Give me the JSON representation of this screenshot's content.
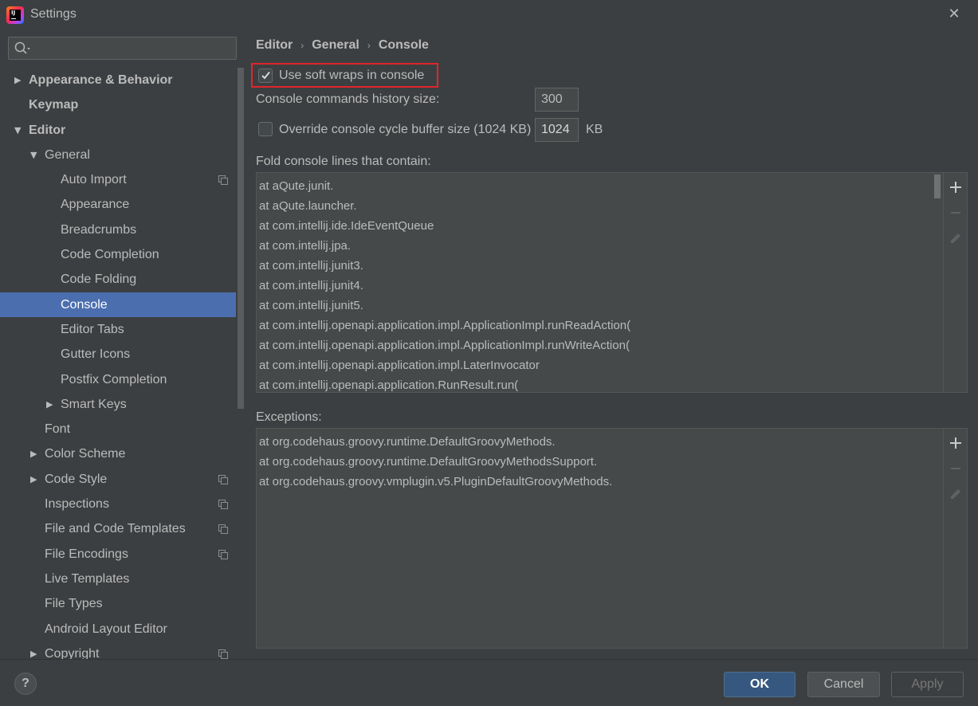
{
  "window": {
    "title": "Settings",
    "close_glyph": "✕"
  },
  "search": {
    "placeholder": "",
    "value": ""
  },
  "sidebar": {
    "items": [
      {
        "label": "Appearance & Behavior",
        "level": 0,
        "arrow": "right",
        "bold": true,
        "selected": false,
        "icon": ""
      },
      {
        "label": "Keymap",
        "level": 0,
        "arrow": "",
        "bold": true,
        "selected": false,
        "icon": ""
      },
      {
        "label": "Editor",
        "level": 0,
        "arrow": "down",
        "bold": true,
        "selected": false,
        "icon": ""
      },
      {
        "label": "General",
        "level": 1,
        "arrow": "down",
        "bold": false,
        "selected": false,
        "icon": ""
      },
      {
        "label": "Auto Import",
        "level": 2,
        "arrow": "",
        "bold": false,
        "selected": false,
        "icon": "copy-icon"
      },
      {
        "label": "Appearance",
        "level": 2,
        "arrow": "",
        "bold": false,
        "selected": false,
        "icon": ""
      },
      {
        "label": "Breadcrumbs",
        "level": 2,
        "arrow": "",
        "bold": false,
        "selected": false,
        "icon": ""
      },
      {
        "label": "Code Completion",
        "level": 2,
        "arrow": "",
        "bold": false,
        "selected": false,
        "icon": ""
      },
      {
        "label": "Code Folding",
        "level": 2,
        "arrow": "",
        "bold": false,
        "selected": false,
        "icon": ""
      },
      {
        "label": "Console",
        "level": 2,
        "arrow": "",
        "bold": false,
        "selected": true,
        "icon": ""
      },
      {
        "label": "Editor Tabs",
        "level": 2,
        "arrow": "",
        "bold": false,
        "selected": false,
        "icon": ""
      },
      {
        "label": "Gutter Icons",
        "level": 2,
        "arrow": "",
        "bold": false,
        "selected": false,
        "icon": ""
      },
      {
        "label": "Postfix Completion",
        "level": 2,
        "arrow": "",
        "bold": false,
        "selected": false,
        "icon": ""
      },
      {
        "label": "Smart Keys",
        "level": 2,
        "arrow": "right",
        "bold": false,
        "selected": false,
        "icon": ""
      },
      {
        "label": "Font",
        "level": 1,
        "arrow": "",
        "bold": false,
        "selected": false,
        "icon": ""
      },
      {
        "label": "Color Scheme",
        "level": 1,
        "arrow": "right",
        "bold": false,
        "selected": false,
        "icon": ""
      },
      {
        "label": "Code Style",
        "level": 1,
        "arrow": "right",
        "bold": false,
        "selected": false,
        "icon": "copy-icon"
      },
      {
        "label": "Inspections",
        "level": 1,
        "arrow": "",
        "bold": false,
        "selected": false,
        "icon": "copy-icon"
      },
      {
        "label": "File and Code Templates",
        "level": 1,
        "arrow": "",
        "bold": false,
        "selected": false,
        "icon": "copy-icon"
      },
      {
        "label": "File Encodings",
        "level": 1,
        "arrow": "",
        "bold": false,
        "selected": false,
        "icon": "copy-icon"
      },
      {
        "label": "Live Templates",
        "level": 1,
        "arrow": "",
        "bold": false,
        "selected": false,
        "icon": ""
      },
      {
        "label": "File Types",
        "level": 1,
        "arrow": "",
        "bold": false,
        "selected": false,
        "icon": ""
      },
      {
        "label": "Android Layout Editor",
        "level": 1,
        "arrow": "",
        "bold": false,
        "selected": false,
        "icon": ""
      },
      {
        "label": "Copyright",
        "level": 1,
        "arrow": "right",
        "bold": false,
        "selected": false,
        "icon": "copy-icon"
      }
    ]
  },
  "breadcrumb": {
    "items": [
      "Editor",
      "General",
      "Console"
    ],
    "separator": "›"
  },
  "options": {
    "soft_wraps_label": "Use soft wraps in console",
    "soft_wraps_checked": true,
    "history_label": "Console commands history size:",
    "history_value": "300",
    "override_label": "Override console cycle buffer size (1024 KB)",
    "override_checked": false,
    "override_value": "1024",
    "override_unit": "KB"
  },
  "fold": {
    "label": "Fold console lines that contain:",
    "items": [
      "at aQute.junit.",
      "at aQute.launcher.",
      "at com.intellij.ide.IdeEventQueue",
      "at com.intellij.jpa.",
      "at com.intellij.junit3.",
      "at com.intellij.junit4.",
      "at com.intellij.junit5.",
      "at com.intellij.openapi.application.impl.ApplicationImpl.runReadAction(",
      "at com.intellij.openapi.application.impl.ApplicationImpl.runWriteAction(",
      "at com.intellij.openapi.application.impl.LaterInvocator",
      "at com.intellij.openapi.application.RunResult.run("
    ]
  },
  "exceptions": {
    "label": "Exceptions:",
    "items": [
      "at org.codehaus.groovy.runtime.DefaultGroovyMethods.",
      "at org.codehaus.groovy.runtime.DefaultGroovyMethodsSupport.",
      "at org.codehaus.groovy.vmplugin.v5.PluginDefaultGroovyMethods."
    ]
  },
  "footer": {
    "help_label": "?",
    "ok_label": "OK",
    "cancel_label": "Cancel",
    "apply_label": "Apply"
  },
  "colors": {
    "background": "#3c3f41",
    "selection": "#4b6eaf",
    "highlight": "#e2242c",
    "ok_button": "#365880"
  }
}
